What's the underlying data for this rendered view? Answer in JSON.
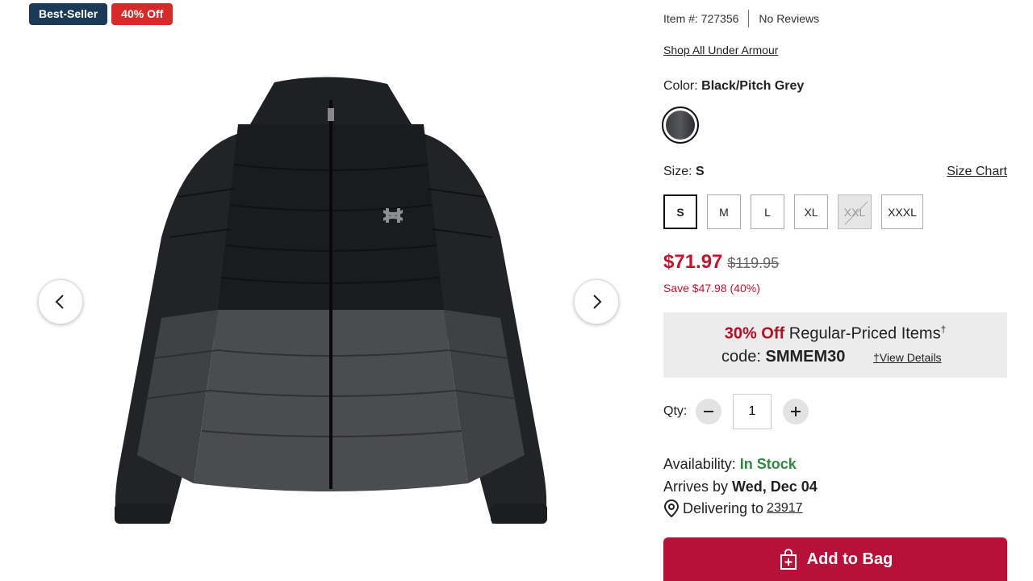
{
  "badges": {
    "best_seller": "Best-Seller",
    "discount": "40% Off"
  },
  "product": {
    "item_number": "Item #: 727356",
    "reviews": "No Reviews",
    "shop_all": "Shop All Under Armour",
    "color_label": "Color:",
    "color_value": "Black/Pitch Grey",
    "size_label": "Size:",
    "size_value": "S",
    "size_chart": "Size Chart",
    "sizes": [
      "S",
      "M",
      "L",
      "XL",
      "XXL",
      "XXXL"
    ],
    "sale_price": "$71.97",
    "original_price": "$119.95",
    "savings": "Save $47.98 (40%)"
  },
  "promo": {
    "percent_off": "30% Off",
    "text": "Regular-Priced Items",
    "dagger": "†",
    "code_label": "code:",
    "code": "SMMEM30",
    "details": "†View Details"
  },
  "qty": {
    "label": "Qty:",
    "value": "1"
  },
  "delivery": {
    "availability_label": "Availability:",
    "availability_value": "In Stock",
    "arrives_label": "Arrives by",
    "arrives_date": "Wed, Dec 04",
    "delivering_label": "Delivering to",
    "zip": "23917"
  },
  "cart": {
    "add_label": "Add to Bag"
  },
  "colors": {
    "accent": "#b7113a",
    "sale": "#c4132f",
    "in_stock": "#2d8a3e",
    "badge_best": "#1b3a57",
    "badge_off": "#d52b2b"
  }
}
